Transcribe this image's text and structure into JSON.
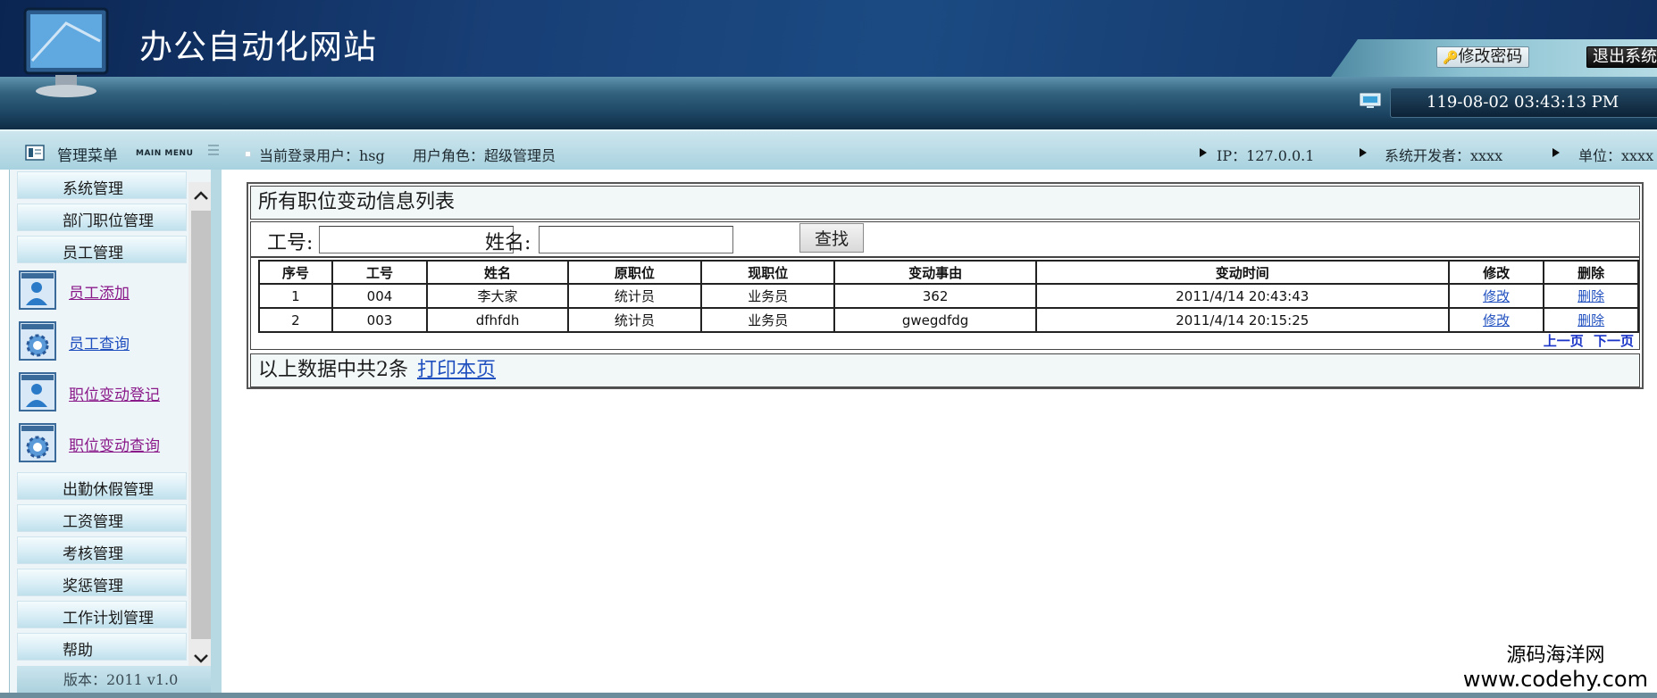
{
  "header": {
    "site_title": "办公自动化网站",
    "change_password": "修改密码",
    "logout": "退出系统",
    "datetime": "119-08-02 03:43:13 PM"
  },
  "infobar": {
    "menu_title": "管理菜单",
    "menu_title_en": "MAIN MENU",
    "current_user": "当前登录用户：hsg",
    "user_role": "用户角色：超级管理员",
    "ip": "IP：127.0.0.1",
    "developer": "系统开发者：xxxx",
    "unit": "单位：xxxx"
  },
  "sidebar": {
    "categories_top": [
      "系统管理",
      "部门职位管理",
      "员工管理"
    ],
    "sub_items": [
      {
        "label": "员工添加",
        "icon": "user-icon",
        "visited": true
      },
      {
        "label": "员工查询",
        "icon": "gear-icon",
        "visited": false
      },
      {
        "label": "职位变动登记",
        "icon": "user-icon",
        "visited": true
      },
      {
        "label": "职位变动查询",
        "icon": "gear-icon",
        "visited": true
      }
    ],
    "categories_bottom": [
      "出勤休假管理",
      "工资管理",
      "考核管理",
      "奖惩管理",
      "工作计划管理",
      "帮助"
    ],
    "version": "版本：2011 v1.0"
  },
  "panel": {
    "title": "所有职位变动信息列表",
    "search": {
      "emp_no_label": "工号:",
      "name_label": "姓名:",
      "emp_no_value": "",
      "name_value": "",
      "button": "查找"
    },
    "table": {
      "headers": [
        "序号",
        "工号",
        "姓名",
        "原职位",
        "现职位",
        "变动事由",
        "变动时间",
        "修改",
        "删除"
      ],
      "rows": [
        [
          "1",
          "004",
          "李大家",
          "统计员",
          "业务员",
          "362",
          "2011/4/14 20:43:43",
          "修改",
          "删除"
        ],
        [
          "2",
          "003",
          "dfhfdh",
          "统计员",
          "业务员",
          "gwegdfdg",
          "2011/4/14 20:15:25",
          "修改",
          "删除"
        ]
      ]
    },
    "pager": {
      "prev": "上一页",
      "next": "下一页"
    },
    "footer_text": "以上数据中共2条",
    "print_link": "打印本页"
  },
  "watermark": {
    "cn": "源码海洋网",
    "url": "www.codehy.com"
  },
  "colors": {
    "link": "#1f4fbf",
    "visited": "#8a1a8a",
    "header_dark": "#0f2244",
    "infobar": "#a8d2df"
  }
}
